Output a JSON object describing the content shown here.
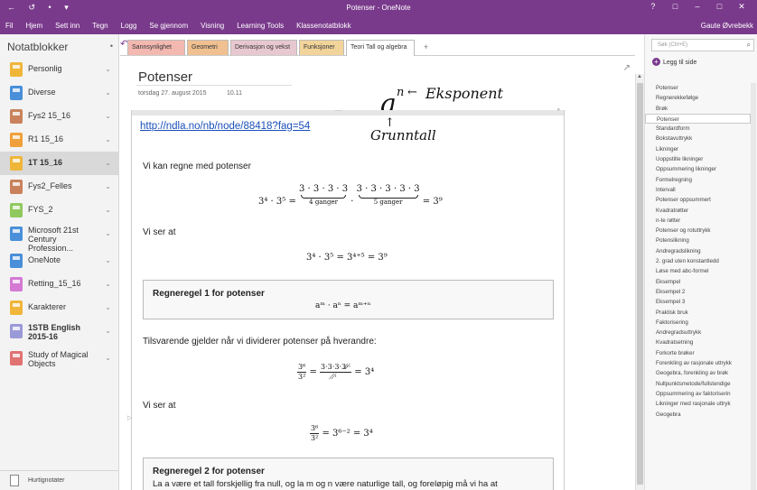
{
  "titlebar": {
    "title": "Potenser - OneNote",
    "qat": "← ↺ • ▾",
    "help": "?",
    "restore_label": "□",
    "minimize": "–",
    "maximize": "□",
    "close": "✕"
  },
  "ribbon": {
    "tabs": [
      "Fil",
      "Hjem",
      "Sett inn",
      "Tegn",
      "Logg",
      "Se gjennom",
      "Visning",
      "Learning Tools",
      "Klassenotatblokk"
    ],
    "user": "Gaute Øvrebekk"
  },
  "notebooks": {
    "header": "Notatblokker",
    "pin": "•",
    "items": [
      {
        "name": "Personlig",
        "color": "#f0b63a"
      },
      {
        "name": "Diverse",
        "color": "#4a8fd9"
      },
      {
        "name": "Fys2 15_16",
        "color": "#c9825b"
      },
      {
        "name": "R1 15_16",
        "color": "#f0a03a"
      },
      {
        "name": "1T 15_16",
        "color": "#f0b63a"
      },
      {
        "name": "Fys2_Felles",
        "color": "#c9825b"
      },
      {
        "name": "FYS_2",
        "color": "#8fc95e"
      },
      {
        "name": "Microsoft 21st Century Profession...",
        "color": "#4a8fd9"
      },
      {
        "name": "OneNote",
        "color": "#4a8fd9"
      },
      {
        "name": "Retting_15_16",
        "color": "#d47ad4"
      },
      {
        "name": "Karakterer",
        "color": "#f0b63a"
      },
      {
        "name": "1STB English 2015-16",
        "color": "#9a9ad8"
      },
      {
        "name": "Study of Magical Objects",
        "color": "#e07272"
      }
    ],
    "selected_index": 4,
    "quicknotes": "Hurtignotater"
  },
  "sections": {
    "back": "↶",
    "tabs": [
      {
        "label": "Sannsynlighet",
        "color": "#f3b8b0"
      },
      {
        "label": "Geometri",
        "color": "#f0c090"
      },
      {
        "label": "Derivasjon og vekst",
        "color": "#e8c8d0"
      },
      {
        "label": "Funksjoner",
        "color": "#f2d49a"
      },
      {
        "label": "Teori Tall og algebra",
        "color": "#ffffff"
      }
    ],
    "add": "+"
  },
  "page": {
    "title": "Potenser",
    "date": "torsdag 27. august 2015",
    "time": "10.11",
    "expand": "↗",
    "ink": {
      "a": "a",
      "n": "n",
      "arrow": "←",
      "eksponent": "Eksponent",
      "up": "↑",
      "grunntall": "Grunntall"
    },
    "link": "http://ndla.no/nb/node/88418?fag=54",
    "grip": "....",
    "bar_arrows": "»",
    "divider": "▷",
    "text1": "Vi kan regne med potenser",
    "eq1_left": "3⁴ · 3⁵ = ",
    "eq1_g1": "3 · 3 · 3 · 3",
    "eq1_g1_label": "4 ganger",
    "eq1_dot": " · ",
    "eq1_g2": "3 · 3 · 3 · 3 · 3",
    "eq1_g2_label": "5 ganger",
    "eq1_right": " = 3⁹",
    "text2": "Vi ser at",
    "eq2": "3⁴ · 3⁵ = 3⁴⁺⁵ = 3⁹",
    "rule1_title": "Regneregel 1 for potenser",
    "rule1_formula": "aᵐ · aⁿ = aᵐ⁺ⁿ",
    "text3": "Tilsvarende gjelder når vi dividerer potenser på hverandre:",
    "eq3_num": "3⁶",
    "eq3_den": "3²",
    "eq3_mid_num": "3·3·3·3·̸·̸",
    "eq3_mid_den": "̸·̸",
    "eq3_right": " = 3⁴",
    "text4": "Vi ser at",
    "eq4_num": "3⁶",
    "eq4_den": "3²",
    "eq4_right": " = 3⁶⁻² = 3⁴",
    "rule2_title": "Regneregel 2 for potenser",
    "rule2_body": "La a være et tall forskjellig fra null, og la m og n være naturlige tall, og foreløpig må vi ha at"
  },
  "pagelist": {
    "search_placeholder": "Søk (Ctrl+E)",
    "search_icon": "⌕",
    "add_page": "Legg til side",
    "add_icon": "+",
    "pages": [
      "Potenser",
      "Regnerekkefølge",
      "Brøk",
      "Potenser",
      "Standardform",
      "Bokstavuttrykk",
      "Likninger",
      "Uoppstilte likninger",
      "Oppsummering likninger",
      "Formelregning",
      "Intervall",
      "Potenser oppsummert",
      "Kvadratrøtter",
      "n-te røtter",
      "Potenser og rotuttrykk",
      "Potenslikning",
      "Andregradslikning",
      "2. grad uten konstantledd",
      "Løse med abc-formel",
      "Eksempel",
      "Eksempel 2",
      "Eksempel 3",
      "Praktisk bruk",
      "Faktorisering",
      "Andregradsuttrykk",
      "Kvadratsetning",
      "Forkorte brøker",
      "Forenkling av rasjonale uttrykk",
      "Geogebra, forenkling av brøk",
      "Nullpunktsmetode/fullstendige",
      "Oppsummering av faktoriserin",
      "Likninger med rasjonale uttryk",
      "Geogebra"
    ],
    "selected_index": 3
  },
  "colors": {
    "accent": "#7a3a8c",
    "link": "#1a4fb8"
  }
}
